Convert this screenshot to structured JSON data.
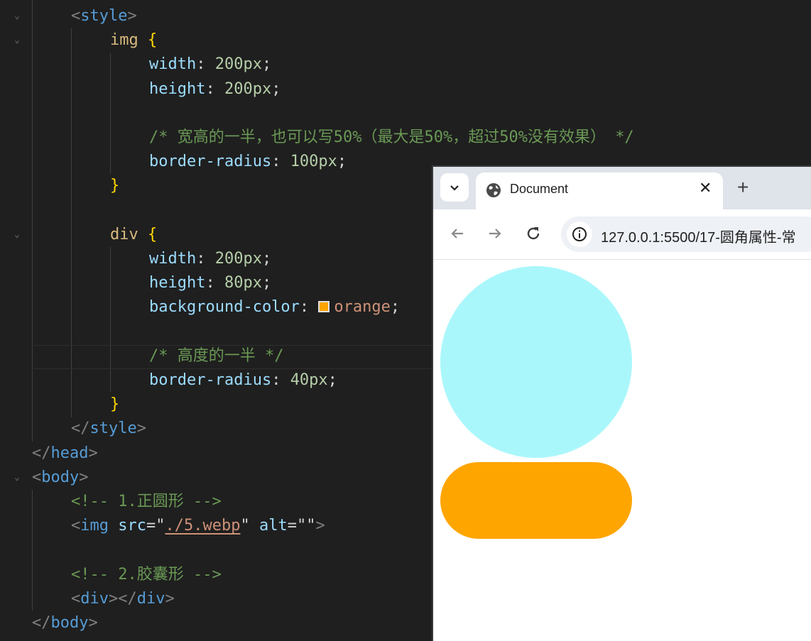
{
  "editor": {
    "lines": [
      [
        [
          "t-punc",
          "<"
        ],
        [
          "t-tag",
          "style"
        ],
        [
          "t-punc",
          ">"
        ]
      ],
      [
        [
          "t-sel",
          "img"
        ],
        [
          "t-plain",
          " "
        ],
        [
          "t-brace",
          "{"
        ]
      ],
      [
        [
          "t-prop",
          "width"
        ],
        [
          "t-plain",
          ": "
        ],
        [
          "t-num",
          "200px"
        ],
        [
          "t-plain",
          ";"
        ]
      ],
      [
        [
          "t-prop",
          "height"
        ],
        [
          "t-plain",
          ": "
        ],
        [
          "t-num",
          "200px"
        ],
        [
          "t-plain",
          ";"
        ]
      ],
      [],
      [
        [
          "t-cm",
          "/* 宽高的一半，也可以写50%（最大是50%，超过50%没有效果） */"
        ]
      ],
      [
        [
          "t-prop",
          "border-radius"
        ],
        [
          "t-plain",
          ": "
        ],
        [
          "t-num",
          "100px"
        ],
        [
          "t-plain",
          ";"
        ]
      ],
      [
        [
          "t-brace",
          "}"
        ]
      ],
      [],
      [
        [
          "t-sel",
          "div"
        ],
        [
          "t-plain",
          " "
        ],
        [
          "t-brace",
          "{"
        ]
      ],
      [
        [
          "t-prop",
          "width"
        ],
        [
          "t-plain",
          ": "
        ],
        [
          "t-num",
          "200px"
        ],
        [
          "t-plain",
          ";"
        ]
      ],
      [
        [
          "t-prop",
          "height"
        ],
        [
          "t-plain",
          ": "
        ],
        [
          "t-num",
          "80px"
        ],
        [
          "t-plain",
          ";"
        ]
      ],
      [
        [
          "t-prop",
          "background-color"
        ],
        [
          "t-plain",
          ": "
        ],
        [
          "swatch",
          ""
        ],
        [
          "t-str",
          "orange"
        ],
        [
          "t-plain",
          ";"
        ]
      ],
      [],
      [
        [
          "t-cm",
          "/* 高度的一半 */"
        ]
      ],
      [
        [
          "t-prop",
          "border-radius"
        ],
        [
          "t-plain",
          ": "
        ],
        [
          "t-num",
          "40px"
        ],
        [
          "t-plain",
          ";"
        ]
      ],
      [
        [
          "t-brace",
          "}"
        ]
      ],
      [
        [
          "t-punc",
          "</"
        ],
        [
          "t-tag",
          "style"
        ],
        [
          "t-punc",
          ">"
        ]
      ],
      [
        [
          "t-punc",
          "</"
        ],
        [
          "t-tag",
          "head"
        ],
        [
          "t-punc",
          ">"
        ]
      ],
      [
        [
          "t-punc",
          "<"
        ],
        [
          "t-tag",
          "body"
        ],
        [
          "t-punc",
          ">"
        ]
      ],
      [
        [
          "t-cm",
          "<!-- 1.正圆形 -->"
        ]
      ],
      [
        [
          "t-punc",
          "<"
        ],
        [
          "t-tag",
          "img"
        ],
        [
          "t-plain",
          " "
        ],
        [
          "t-attr",
          "src"
        ],
        [
          "t-plain",
          "=\""
        ],
        [
          "t-link",
          "./5.webp"
        ],
        [
          "t-plain",
          "\" "
        ],
        [
          "t-attr",
          "alt"
        ],
        [
          "t-plain",
          "=\"\""
        ],
        [
          "t-punc",
          ">"
        ]
      ],
      [],
      [
        [
          "t-cm",
          "<!-- 2.胶囊形 -->"
        ]
      ],
      [
        [
          "t-punc",
          "<"
        ],
        [
          "t-tag",
          "div"
        ],
        [
          "t-punc",
          "></"
        ],
        [
          "t-tag",
          "div"
        ],
        [
          "t-punc",
          ">"
        ]
      ],
      [
        [
          "t-punc",
          "</"
        ],
        [
          "t-tag",
          "body"
        ],
        [
          "t-punc",
          ">"
        ]
      ]
    ],
    "swatch_color": "#ffa500"
  },
  "browser": {
    "tab_title": "Document",
    "close_glyph": "✕",
    "new_tab_glyph": "+",
    "url": "127.0.0.1:5500/17-圆角属性-常",
    "circle_color": "#aaf7fb",
    "capsule_color": "#ffa500"
  }
}
